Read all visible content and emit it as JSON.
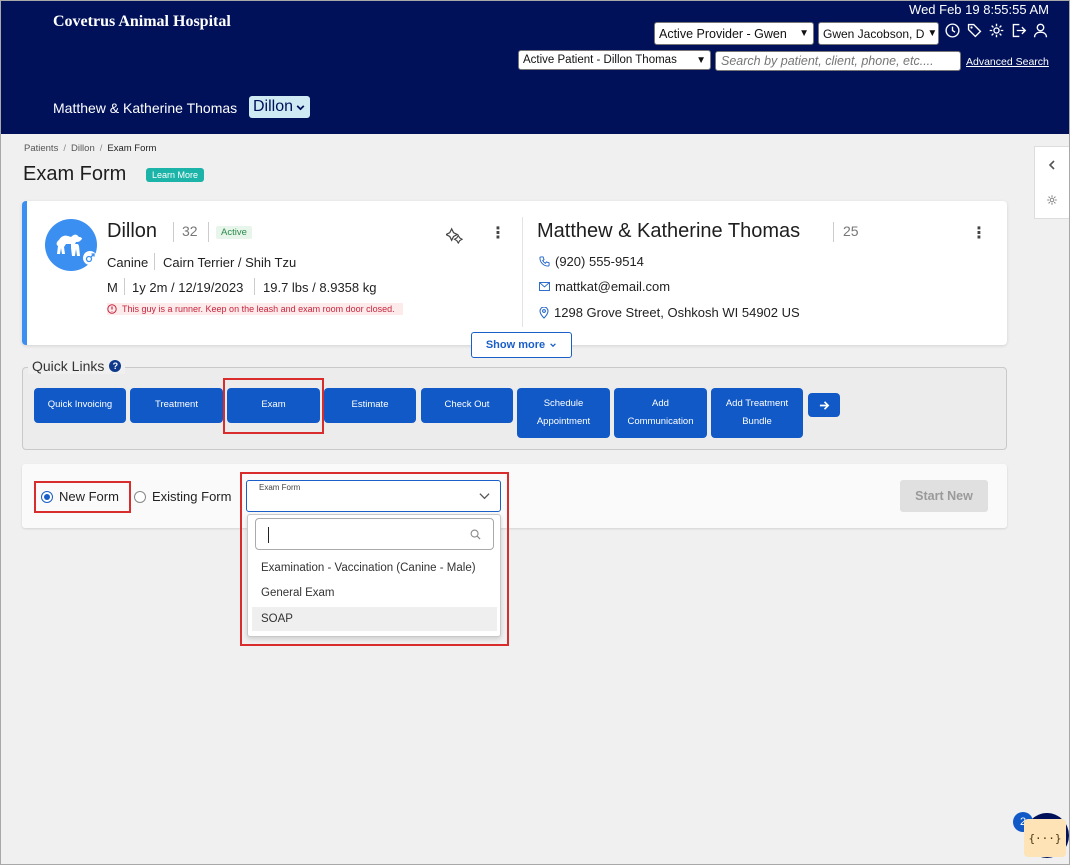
{
  "header": {
    "hospital_name": "Covetrus Animal Hospital",
    "datetime": "Wed Feb 19 8:55:55 AM",
    "active_provider": "Active Provider - Gwen",
    "user_select": "Gwen Jacobson, D",
    "active_patient": "Active Patient - Dillon Thomas",
    "search_placeholder": "Search by patient, client, phone, etc....",
    "advanced_search": "Advanced Search",
    "client_name": "Matthew & Katherine Thomas",
    "patient_select": "Dillon",
    "icons": [
      "clock-icon",
      "tag-icon",
      "gear-icon",
      "logout-icon",
      "user-icon"
    ]
  },
  "breadcrumb": [
    "Patients",
    "Dillon",
    "Exam Form"
  ],
  "page": {
    "title": "Exam Form",
    "learn_more": "Learn More"
  },
  "patient": {
    "name": "Dillon",
    "id": "32",
    "status": "Active",
    "species": "Canine",
    "breed": "Cairn Terrier / Shih Tzu",
    "sex": "M",
    "age": "1y 2m / 12/19/2023",
    "weight": "19.7 lbs / 8.9358 kg",
    "alert": "This guy is a runner. Keep on the leash and exam room door closed."
  },
  "client": {
    "name": "Matthew & Katherine Thomas",
    "id": "25",
    "phone": "(920) 555-9514",
    "email": "mattkat@email.com",
    "address": "1298 Grove Street, Oshkosh WI 54902 US"
  },
  "show_more": "Show more",
  "quick_links": {
    "title": "Quick Links",
    "items": [
      {
        "line1": "Quick Invoicing",
        "line2": ""
      },
      {
        "line1": "Treatment",
        "line2": ""
      },
      {
        "line1": "Exam",
        "line2": ""
      },
      {
        "line1": "Estimate",
        "line2": ""
      },
      {
        "line1": "Check Out",
        "line2": ""
      },
      {
        "line1": "Schedule",
        "line2": "Appointment"
      },
      {
        "line1": "Add",
        "line2": "Communication"
      },
      {
        "line1": "Add Treatment",
        "line2": "Bundle"
      }
    ]
  },
  "form": {
    "new_form": "New Form",
    "existing_form": "Existing Form",
    "selected_mode": "New Form",
    "select_label": "Exam Form",
    "start_new": "Start New",
    "options": [
      "Examination - Vaccination (Canine - Male)",
      "General Exam",
      "SOAP"
    ],
    "highlighted_option": "SOAP"
  },
  "chat": {
    "badge_count": "2",
    "chip_text": "{···}"
  },
  "colors": {
    "header_bg": "#00115a",
    "primary": "#1059c7",
    "highlight": "#d92c2c",
    "active_badge": "#2b8a4d",
    "alert_text": "#c7253e"
  }
}
